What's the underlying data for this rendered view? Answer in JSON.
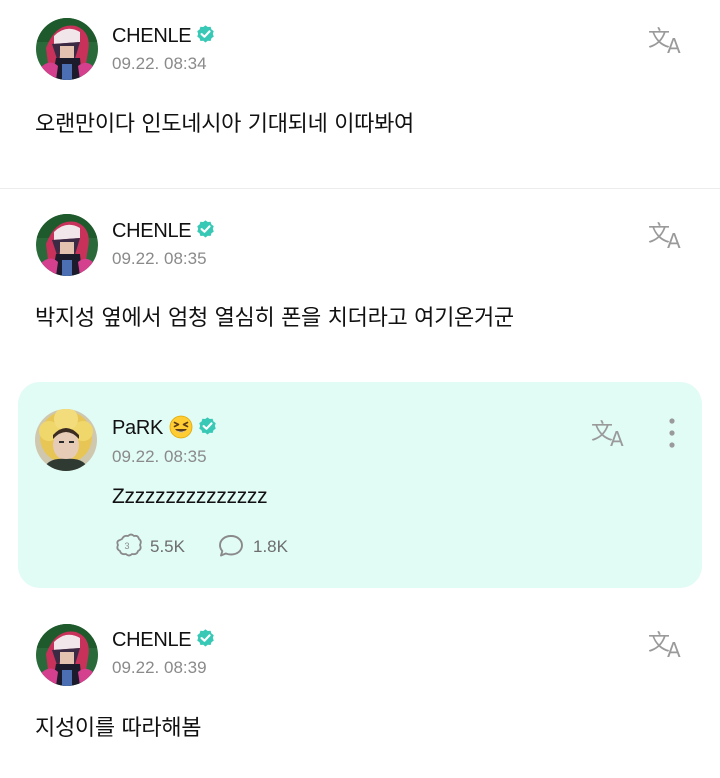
{
  "colors": {
    "verified": "#38c9b6",
    "reply_background": "#e1fbf5",
    "date_text": "#8a8a8a",
    "divider": "#ececec"
  },
  "posts": [
    {
      "author": "CHENLE",
      "date": "09.22. 08:34",
      "text": "오랜만이다 인도네시아 기대되네 이따봐여",
      "avatar_icon": "avatar-image",
      "translate_icon": "translate-icon"
    },
    {
      "author": "CHENLE",
      "date": "09.22. 08:35",
      "text": "박지성 옆에서 엄청 열심히 폰을 치더라고 여기온거군",
      "avatar_icon": "avatar-image",
      "translate_icon": "translate-icon"
    }
  ],
  "reply": {
    "author": "PaRK",
    "emoji": "laughing-squint-emoji",
    "date": "09.22. 08:35",
    "text": "Zzzzzzzzzzzzzzz",
    "likes": "5.5K",
    "comments": "1.8K",
    "menu_icon": "more-vertical-icon"
  },
  "post3": {
    "author": "CHENLE",
    "date": "09.22. 08:39",
    "text": "지성이를 따라해봄"
  }
}
